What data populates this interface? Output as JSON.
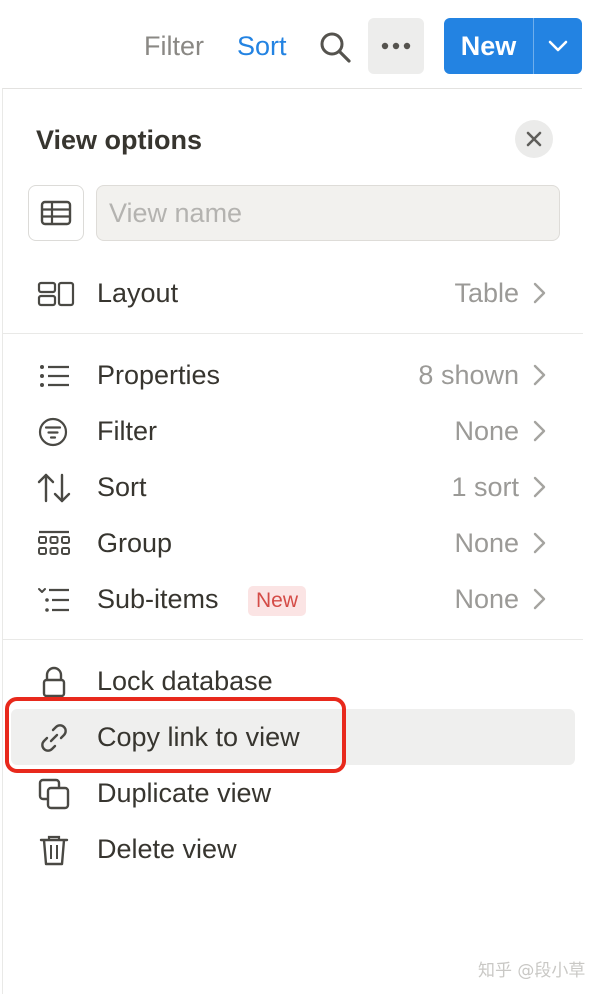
{
  "toolbar": {
    "filter_label": "Filter",
    "sort_label": "Sort",
    "new_label": "New",
    "search_icon": "search-icon",
    "more_icon": "more-horizontal-icon",
    "new_menu_icon": "chevron-down-icon"
  },
  "panel": {
    "title": "View options",
    "close_icon": "close-icon",
    "view_icon": "table-icon",
    "view_name_placeholder": "View name",
    "view_name_value": ""
  },
  "rows": {
    "layout": {
      "label": "Layout",
      "value": "Table",
      "icon": "layout-icon"
    },
    "properties": {
      "label": "Properties",
      "value": "8 shown",
      "icon": "list-icon"
    },
    "filter": {
      "label": "Filter",
      "value": "None",
      "icon": "filter-icon"
    },
    "sort": {
      "label": "Sort",
      "value": "1 sort",
      "icon": "sort-icon"
    },
    "group": {
      "label": "Group",
      "value": "None",
      "icon": "group-icon"
    },
    "subitems": {
      "label": "Sub-items",
      "badge": "New",
      "value": "None",
      "icon": "subitems-icon"
    },
    "lock": {
      "label": "Lock database",
      "icon": "lock-icon"
    },
    "copy_link": {
      "label": "Copy link to view",
      "icon": "link-icon"
    },
    "duplicate": {
      "label": "Duplicate view",
      "icon": "duplicate-icon"
    },
    "delete": {
      "label": "Delete view",
      "icon": "trash-icon"
    }
  },
  "watermark": "知乎 @段小草",
  "colors": {
    "accent": "#2383e2",
    "highlight_border": "#e8291c",
    "badge_bg": "#fbe4e4",
    "badge_text": "#d44c47"
  }
}
